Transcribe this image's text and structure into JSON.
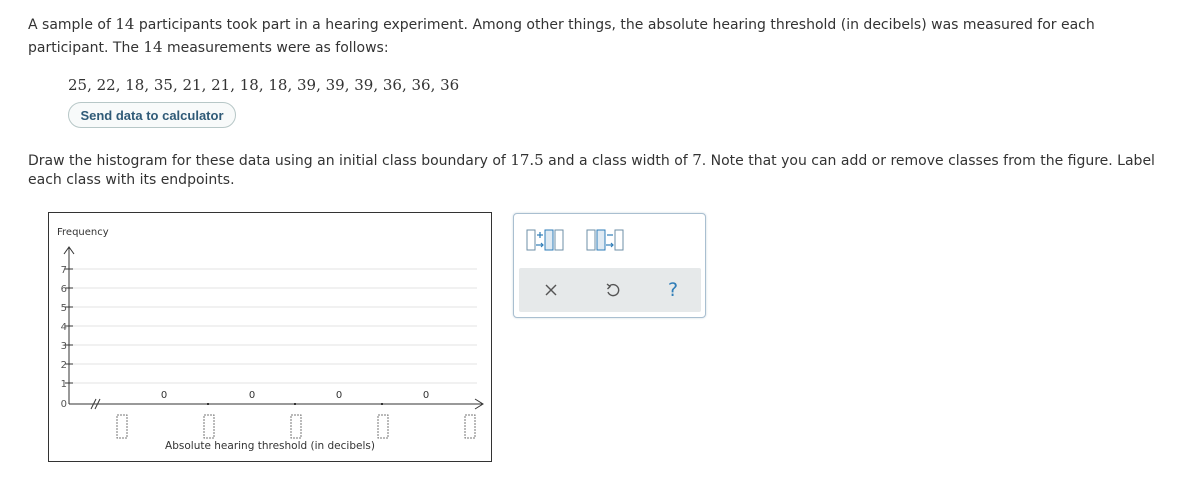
{
  "intro": {
    "line1_pre": "A sample of ",
    "n": "14",
    "line1_post": " participants took part in a hearing experiment. Among other things, the absolute hearing threshold (in decibels) was measured for each",
    "line2_pre": "participant. The ",
    "n2": "14",
    "line2_post": " measurements were as follows:"
  },
  "measurements": "25, 22, 18, 35, 21, 21, 18, 18, 39, 39, 39, 36, 36, 36",
  "send_button_label": "Send data to calculator",
  "instruction": {
    "pre1": "Draw the histogram for these data using an initial class boundary of ",
    "boundary": "17.5",
    "mid1": " and a class width of ",
    "width": "7",
    "post1": ". Note that you can add or remove classes from the figure. Label",
    "line2": "each class with its endpoints."
  },
  "graph": {
    "y_label": "Frequency",
    "x_label": "Absolute hearing threshold (in decibels)",
    "y_ticks": [
      "0",
      "1",
      "2",
      "3",
      "4",
      "5",
      "6",
      "7"
    ],
    "bar_labels": [
      "0",
      "0",
      "0",
      "0"
    ],
    "endpoint_inputs": [
      "",
      "",
      "",
      "",
      ""
    ]
  },
  "tools": {
    "add_class_icon": "add-class-icon",
    "remove_class_icon": "remove-class-icon",
    "clear_icon": "close-icon",
    "undo_icon": "undo-icon",
    "help_label": "?"
  },
  "colors": {
    "accent": "#2f5a77",
    "panel_border": "#a9bfd0",
    "panel_row_bg": "#e6e9ea",
    "grid": "#e3e3e3"
  }
}
